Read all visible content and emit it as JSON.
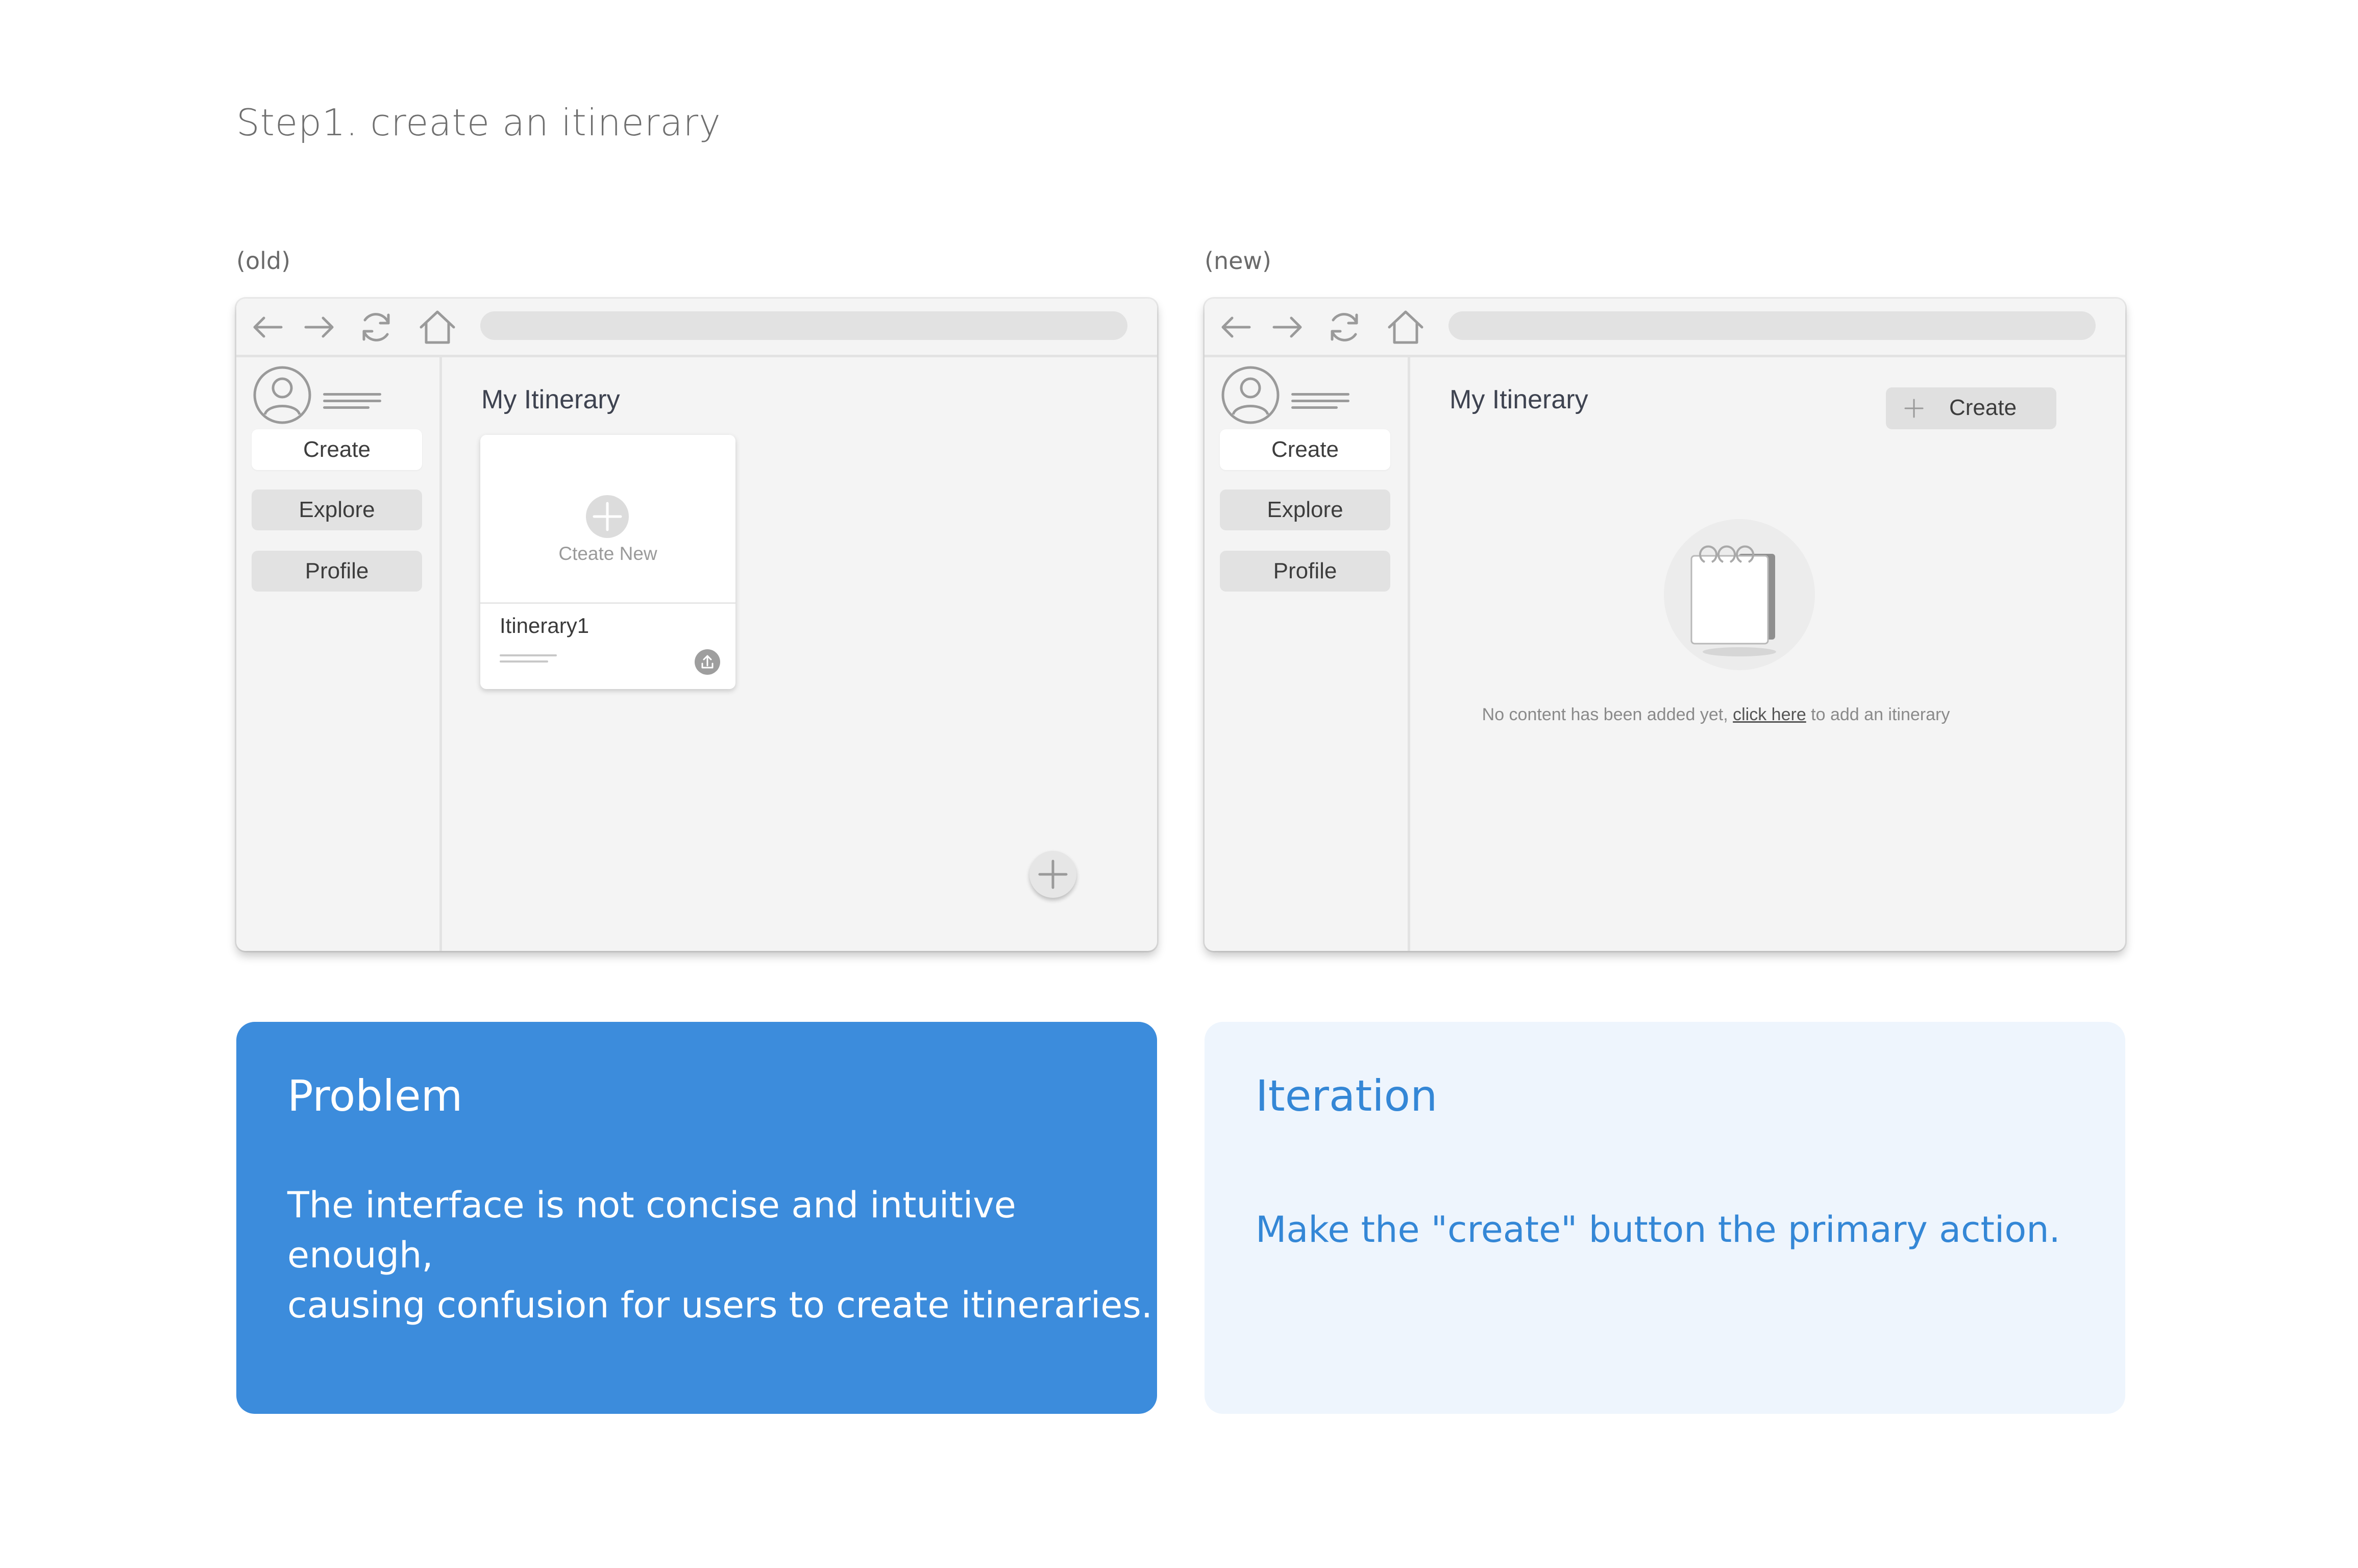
{
  "page_title": "Step1. create an itinerary",
  "old": {
    "label": "(old)",
    "sidebar": {
      "items": [
        "Create",
        "Explore",
        "Profile"
      ]
    },
    "content_title": "My Itinerary",
    "card": {
      "create_new_label": "Cteate New",
      "itinerary_title": "Itinerary1"
    }
  },
  "new": {
    "label": "(new)",
    "sidebar": {
      "items": [
        "Create",
        "Explore",
        "Profile"
      ]
    },
    "content_title": "My Itinerary",
    "create_button": "Create",
    "empty_state": {
      "before": "No content has been added yet, ",
      "link": "click here",
      "after": " to add an itinerary"
    }
  },
  "problem": {
    "heading": "Problem",
    "body_line1": "The interface is not concise and intuitive enough,",
    "body_line2": "causing confusion for users to create itineraries."
  },
  "iteration": {
    "heading": "Iteration",
    "body": "Make the \"create\" button the primary action."
  },
  "icons": {
    "nav": [
      "back-arrow-icon",
      "forward-arrow-icon",
      "refresh-icon",
      "home-icon"
    ],
    "profile": "user-avatar-icon",
    "empty": "notebook-icon"
  },
  "colors": {
    "problem_bg": "#3c8cdc",
    "problem_text": "#ffffff",
    "iteration_bg": "#eef5fd",
    "iteration_text": "#3487d6",
    "browser_bg": "#f4f4f4",
    "button_gray": "#e2e2e2"
  }
}
